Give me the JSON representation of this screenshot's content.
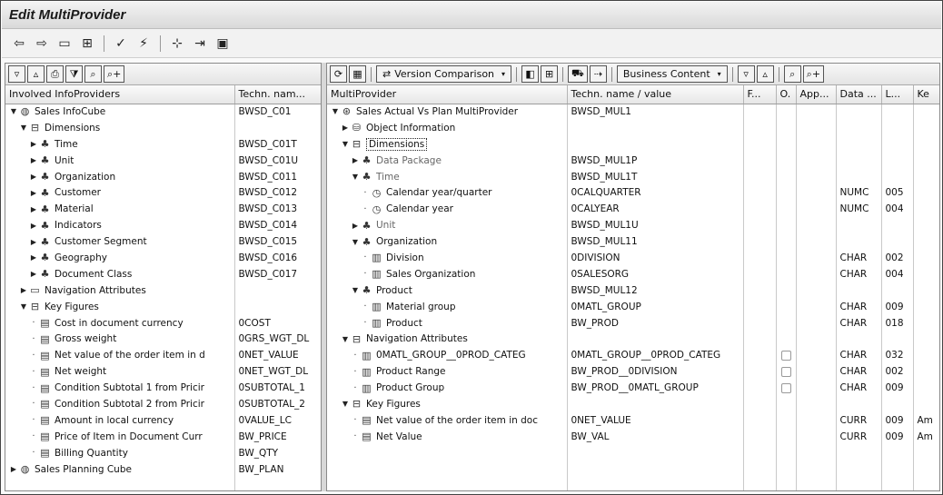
{
  "window": {
    "title": "Edit MultiProvider"
  },
  "app_toolbar": {
    "icons": [
      "back-icon",
      "forward-icon",
      "display-icon",
      "hierarchy-icon",
      "check-icon",
      "activate-icon",
      "where-used-icon",
      "object-catalog-icon",
      "import-icon",
      "save-icon"
    ]
  },
  "left": {
    "toolbar_icons": [
      "expand-icon",
      "collapse-icon",
      "print-icon",
      "filter-icon",
      "find-icon",
      "find-next-icon"
    ],
    "columns": [
      "Involved InfoProviders",
      "Techn. nam..."
    ],
    "rows": [
      {
        "level": 0,
        "arrow": "down",
        "icon": "cube-icon",
        "label": "Sales InfoCube",
        "tech": "BWSD_C01"
      },
      {
        "level": 1,
        "arrow": "down",
        "icon": "folder-open-icon",
        "label": "Dimensions",
        "tech": ""
      },
      {
        "level": 2,
        "arrow": "right",
        "icon": "dimension-icon",
        "label": "Time",
        "tech": "BWSD_C01T"
      },
      {
        "level": 2,
        "arrow": "right",
        "icon": "dimension-icon",
        "label": "Unit",
        "tech": "BWSD_C01U"
      },
      {
        "level": 2,
        "arrow": "right",
        "icon": "dimension-icon",
        "label": "Organization",
        "tech": "BWSD_C011"
      },
      {
        "level": 2,
        "arrow": "right",
        "icon": "dimension-icon",
        "label": "Customer",
        "tech": "BWSD_C012"
      },
      {
        "level": 2,
        "arrow": "right",
        "icon": "dimension-icon",
        "label": "Material",
        "tech": "BWSD_C013"
      },
      {
        "level": 2,
        "arrow": "right",
        "icon": "dimension-icon",
        "label": "Indicators",
        "tech": "BWSD_C014"
      },
      {
        "level": 2,
        "arrow": "right",
        "icon": "dimension-icon",
        "label": "Customer Segment",
        "tech": "BWSD_C015"
      },
      {
        "level": 2,
        "arrow": "right",
        "icon": "dimension-icon",
        "label": "Geography",
        "tech": "BWSD_C016"
      },
      {
        "level": 2,
        "arrow": "right",
        "icon": "dimension-icon",
        "label": "Document Class",
        "tech": "BWSD_C017"
      },
      {
        "level": 1,
        "arrow": "right",
        "icon": "folder-icon",
        "label": "Navigation Attributes",
        "tech": ""
      },
      {
        "level": 1,
        "arrow": "down",
        "icon": "folder-open-icon",
        "label": "Key Figures",
        "tech": ""
      },
      {
        "level": 2,
        "arrow": "dot",
        "icon": "key-figure-icon",
        "label": "Cost in document currency",
        "tech": "0COST"
      },
      {
        "level": 2,
        "arrow": "dot",
        "icon": "key-figure-icon",
        "label": "Gross weight",
        "tech": "0GRS_WGT_DL"
      },
      {
        "level": 2,
        "arrow": "dot",
        "icon": "key-figure-icon",
        "label": "Net value of the order item in d",
        "tech": "0NET_VALUE"
      },
      {
        "level": 2,
        "arrow": "dot",
        "icon": "key-figure-icon",
        "label": "Net weight",
        "tech": "0NET_WGT_DL"
      },
      {
        "level": 2,
        "arrow": "dot",
        "icon": "key-figure-icon",
        "label": "Condition Subtotal 1 from Pricir",
        "tech": "0SUBTOTAL_1"
      },
      {
        "level": 2,
        "arrow": "dot",
        "icon": "key-figure-icon",
        "label": "Condition Subtotal 2 from Pricir",
        "tech": "0SUBTOTAL_2"
      },
      {
        "level": 2,
        "arrow": "dot",
        "icon": "key-figure-icon",
        "label": "Amount in local currency",
        "tech": "0VALUE_LC"
      },
      {
        "level": 2,
        "arrow": "dot",
        "icon": "key-figure-icon",
        "label": "Price of Item in Document Curr",
        "tech": "BW_PRICE"
      },
      {
        "level": 2,
        "arrow": "dot",
        "icon": "key-figure-icon",
        "label": "Billing Quantity",
        "tech": "BW_QTY"
      },
      {
        "level": 0,
        "arrow": "right",
        "icon": "cube-icon",
        "label": "Sales Planning Cube",
        "tech": "BW_PLAN"
      }
    ]
  },
  "right": {
    "toolbar": {
      "version_comparison": "Version Comparison",
      "business_content": "Business Content"
    },
    "columns": [
      "MultiProvider",
      "Techn. name / value",
      "F...",
      "O.",
      "App...",
      "Data ...",
      "L...",
      "Ke"
    ],
    "rows": [
      {
        "level": 0,
        "arrow": "down",
        "icon": "multiprovider-icon",
        "label": "Sales Actual Vs Plan MultiProvider",
        "tech": "BWSD_MUL1",
        "check": false,
        "dtype": "",
        "len": "",
        "ke": ""
      },
      {
        "level": 1,
        "arrow": "right",
        "icon": "info-icon",
        "label": "Object Information",
        "tech": "",
        "check": false,
        "dtype": "",
        "len": "",
        "ke": ""
      },
      {
        "level": 1,
        "arrow": "down",
        "icon": "folder-open-icon",
        "label": "Dimensions",
        "tech": "",
        "check": false,
        "dtype": "",
        "len": "",
        "ke": "",
        "boxed": true
      },
      {
        "level": 2,
        "arrow": "right",
        "icon": "dimension-icon",
        "label": "Data Package",
        "tech": "BWSD_MUL1P",
        "check": false,
        "dtype": "",
        "len": "",
        "ke": "",
        "grey": true
      },
      {
        "level": 2,
        "arrow": "down",
        "icon": "dimension-icon",
        "label": "Time",
        "tech": "BWSD_MUL1T",
        "check": false,
        "dtype": "",
        "len": "",
        "ke": "",
        "grey": true
      },
      {
        "level": 3,
        "arrow": "dot",
        "icon": "clock-icon",
        "label": "Calendar year/quarter",
        "tech": "0CALQUARTER",
        "check": false,
        "dtype": "NUMC",
        "len": "005",
        "ke": ""
      },
      {
        "level": 3,
        "arrow": "dot",
        "icon": "clock-icon",
        "label": "Calendar year",
        "tech": "0CALYEAR",
        "check": false,
        "dtype": "NUMC",
        "len": "004",
        "ke": ""
      },
      {
        "level": 2,
        "arrow": "right",
        "icon": "dimension-icon",
        "label": "Unit",
        "tech": "BWSD_MUL1U",
        "check": false,
        "dtype": "",
        "len": "",
        "ke": "",
        "grey": true
      },
      {
        "level": 2,
        "arrow": "down",
        "icon": "dimension-icon",
        "label": "Organization",
        "tech": "BWSD_MUL11",
        "check": false,
        "dtype": "",
        "len": "",
        "ke": ""
      },
      {
        "level": 3,
        "arrow": "dot",
        "icon": "characteristic-icon",
        "label": "Division",
        "tech": "0DIVISION",
        "check": false,
        "dtype": "CHAR",
        "len": "002",
        "ke": ""
      },
      {
        "level": 3,
        "arrow": "dot",
        "icon": "characteristic-icon",
        "label": "Sales Organization",
        "tech": "0SALESORG",
        "check": false,
        "dtype": "CHAR",
        "len": "004",
        "ke": ""
      },
      {
        "level": 2,
        "arrow": "down",
        "icon": "dimension-icon",
        "label": "Product",
        "tech": "BWSD_MUL12",
        "check": false,
        "dtype": "",
        "len": "",
        "ke": ""
      },
      {
        "level": 3,
        "arrow": "dot",
        "icon": "characteristic-icon",
        "label": "Material group",
        "tech": "0MATL_GROUP",
        "check": false,
        "dtype": "CHAR",
        "len": "009",
        "ke": ""
      },
      {
        "level": 3,
        "arrow": "dot",
        "icon": "characteristic-icon",
        "label": "Product",
        "tech": "BW_PROD",
        "check": false,
        "dtype": "CHAR",
        "len": "018",
        "ke": ""
      },
      {
        "level": 1,
        "arrow": "down",
        "icon": "folder-open-icon",
        "label": "Navigation Attributes",
        "tech": "",
        "check": false,
        "dtype": "",
        "len": "",
        "ke": ""
      },
      {
        "level": 2,
        "arrow": "dot",
        "icon": "characteristic-icon",
        "label": "0MATL_GROUP__0PROD_CATEG",
        "tech": "0MATL_GROUP__0PROD_CATEG",
        "check": true,
        "dtype": "CHAR",
        "len": "032",
        "ke": ""
      },
      {
        "level": 2,
        "arrow": "dot",
        "icon": "characteristic-icon",
        "label": "Product Range",
        "tech": "BW_PROD__0DIVISION",
        "check": true,
        "dtype": "CHAR",
        "len": "002",
        "ke": ""
      },
      {
        "level": 2,
        "arrow": "dot",
        "icon": "characteristic-icon",
        "label": "Product Group",
        "tech": "BW_PROD__0MATL_GROUP",
        "check": true,
        "dtype": "CHAR",
        "len": "009",
        "ke": ""
      },
      {
        "level": 1,
        "arrow": "down",
        "icon": "folder-open-icon",
        "label": "Key Figures",
        "tech": "",
        "check": false,
        "dtype": "",
        "len": "",
        "ke": ""
      },
      {
        "level": 2,
        "arrow": "dot",
        "icon": "key-figure-icon",
        "label": "Net value of the order item in doc",
        "tech": "0NET_VALUE",
        "check": false,
        "dtype": "CURR",
        "len": "009",
        "ke": "Am"
      },
      {
        "level": 2,
        "arrow": "dot",
        "icon": "key-figure-icon",
        "label": "Net Value",
        "tech": "BW_VAL",
        "check": false,
        "dtype": "CURR",
        "len": "009",
        "ke": "Am"
      }
    ]
  }
}
